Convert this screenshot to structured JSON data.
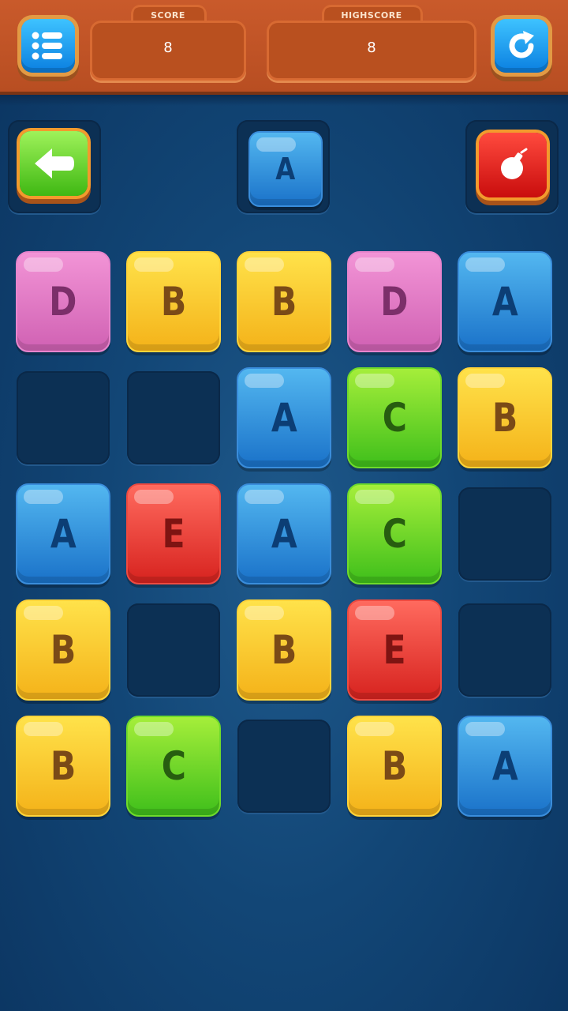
{
  "header": {
    "score_label": "SCORE",
    "score_value": "8",
    "highscore_label": "HIGHSCORE",
    "highscore_value": "8"
  },
  "next_tile": "A",
  "board": [
    [
      "D",
      "B",
      "B",
      "D",
      "A"
    ],
    [
      "",
      "",
      "A",
      "C",
      "B"
    ],
    [
      "A",
      "E",
      "A",
      "C",
      ""
    ],
    [
      "B",
      "",
      "B",
      "E",
      ""
    ],
    [
      "B",
      "C",
      "",
      "B",
      "A"
    ]
  ],
  "icons": {
    "menu": "menu-list-icon",
    "restart": "restart-icon",
    "undo": "arrow-left-icon",
    "bomb": "bomb-icon"
  }
}
